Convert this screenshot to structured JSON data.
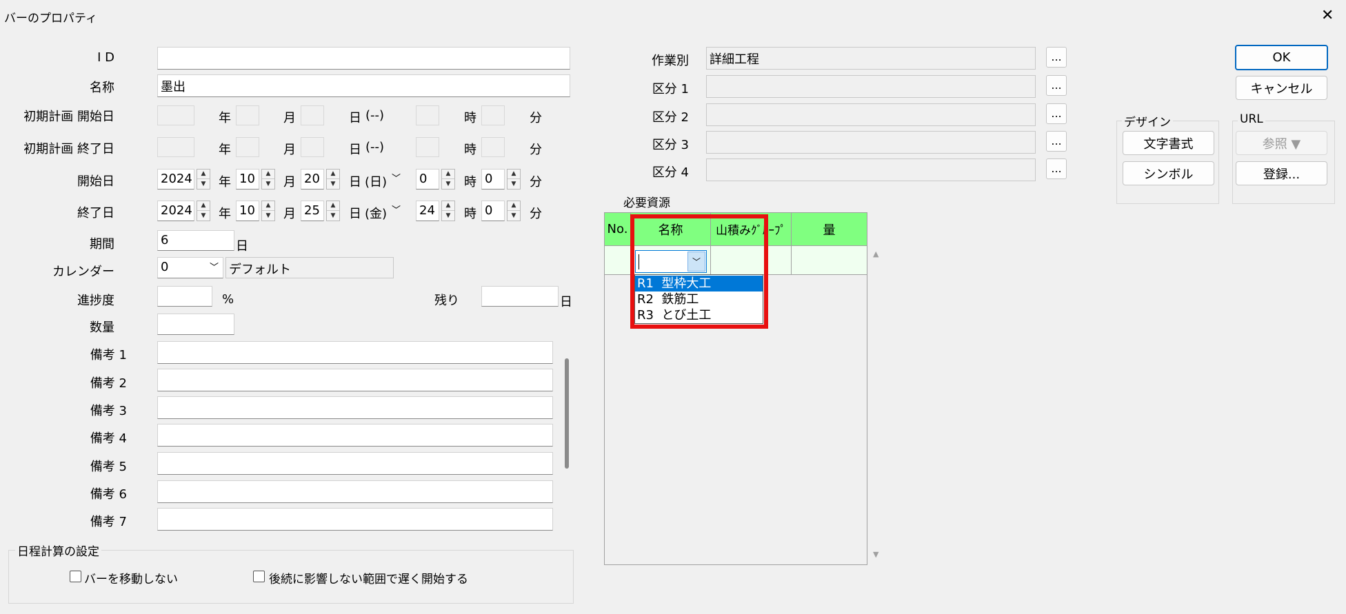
{
  "window": {
    "title": "バーのプロパティ",
    "close_glyph": "✕"
  },
  "fields": {
    "id": {
      "label": "I D",
      "value": ""
    },
    "name": {
      "label": "名称",
      "value": "墨出"
    },
    "initial_start": {
      "label": "初期計画 開始日"
    },
    "initial_end": {
      "label": "初期計画 終了日"
    },
    "start": {
      "label": "開始日",
      "year": "2024",
      "month": "10",
      "day": "20",
      "weekday": "(日)",
      "hour": "0",
      "minute": "0"
    },
    "end": {
      "label": "終了日",
      "year": "2024",
      "month": "10",
      "day": "25",
      "weekday": "(金)",
      "hour": "24",
      "minute": "0"
    },
    "period": {
      "label": "期間",
      "value": "6",
      "unit": "日"
    },
    "calendar": {
      "label": "カレンダー",
      "value": "0",
      "name": "デフォルト"
    },
    "progress": {
      "label": "進捗度",
      "value": "",
      "unit": "%"
    },
    "remaining": {
      "label": "残り",
      "value": "",
      "unit": "日"
    },
    "quantity": {
      "label": "数量",
      "value": ""
    }
  },
  "date_units": {
    "year": "年",
    "month": "月",
    "day": "日",
    "hour": "時",
    "minute": "分",
    "weekday_empty": "(--)"
  },
  "remarks": [
    {
      "label": "備考 1",
      "value": ""
    },
    {
      "label": "備考 2",
      "value": ""
    },
    {
      "label": "備考 3",
      "value": ""
    },
    {
      "label": "備考 4",
      "value": ""
    },
    {
      "label": "備考 5",
      "value": ""
    },
    {
      "label": "備考 6",
      "value": ""
    },
    {
      "label": "備考 7",
      "value": ""
    }
  ],
  "schedule_settings": {
    "title": "日程計算の設定",
    "dont_move": {
      "label": "バーを移動しない",
      "checked": false
    },
    "delay_start": {
      "label": "後続に影響しない範囲で遅く開始する",
      "checked": false
    }
  },
  "categories": [
    {
      "label": "作業別",
      "value": "詳細工程",
      "button": "..."
    },
    {
      "label": "区分 1",
      "value": "",
      "button": "..."
    },
    {
      "label": "区分 2",
      "value": "",
      "button": "..."
    },
    {
      "label": "区分 3",
      "value": "",
      "button": "..."
    },
    {
      "label": "区分 4",
      "value": "",
      "button": "..."
    }
  ],
  "resources": {
    "title": "必要資源",
    "columns": [
      "No.",
      "名称",
      "山積みｸﾞﾙｰﾌﾟ",
      "量"
    ],
    "header_color": "#80ff80",
    "row_color": "#f0fff0",
    "edit_value": "",
    "dropdown_options": [
      {
        "code": "R1",
        "name": "型枠大工",
        "selected": true
      },
      {
        "code": "R2",
        "name": "鉄筋工",
        "selected": false
      },
      {
        "code": "R3",
        "name": "とび土工",
        "selected": false
      }
    ],
    "highlight_color": "#e81010"
  },
  "buttons": {
    "ok": "OK",
    "cancel": "キャンセル"
  },
  "design": {
    "title": "デザイン",
    "text_format": "文字書式",
    "symbol": "シンボル"
  },
  "url": {
    "title": "URL",
    "browse": "参照 ▼",
    "register": "登録..."
  }
}
